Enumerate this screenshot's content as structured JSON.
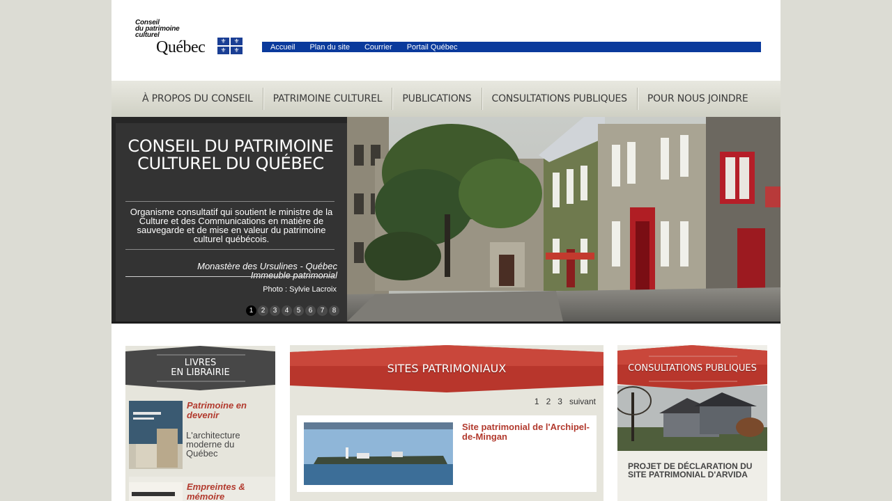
{
  "logo": {
    "line1": "Conseil",
    "line2": "du patrimoine",
    "line3": "culturel",
    "brand": "Québec"
  },
  "topbar": {
    "links": [
      "Accueil",
      "Plan du site",
      "Courrier",
      "Portail Québec"
    ]
  },
  "nav": {
    "items": [
      "À PROPOS DU CONSEIL",
      "PATRIMOINE CULTUREL",
      "PUBLICATIONS",
      "CONSULTATIONS PUBLIQUES",
      "POUR NOUS JOINDRE"
    ]
  },
  "hero": {
    "title": "CONSEIL DU PATRIMOINE CULTUREL DU QUÉBEC",
    "description": "Organisme consultatif qui soutient le ministre de la Culture et des Communications en matière de sauvegarde et de mise en valeur du patrimoine culturel québécois.",
    "caption_line1": "Monastère des Ursulines - Québec",
    "caption_line2": "Immeuble patrimonial",
    "credit": "Photo : Sylvie Lacroix",
    "slides": [
      "1",
      "2",
      "3",
      "4",
      "5",
      "6",
      "7",
      "8"
    ],
    "active_slide": 1
  },
  "books": {
    "heading_line1": "LIVRES",
    "heading_line2": "EN LIBRAIRIE",
    "items": [
      {
        "title": "Patrimoine en devenir",
        "subtitle": "L'architecture moderne du Québec"
      },
      {
        "title": "Empreintes & mémoire",
        "subtitle": ""
      }
    ]
  },
  "sites": {
    "heading": "SITES PATRIMONIAUX",
    "pages": [
      "1",
      "2",
      "3"
    ],
    "next_label": "suivant",
    "card_title": "Site patrimonial de l'Archipel-de-Mingan"
  },
  "consultations": {
    "heading": "CONSULTATIONS PUBLIQUES",
    "item_title": "PROJET DE DÉCLARATION DU SITE PATRIMONIAL D'ARVIDA"
  },
  "colors": {
    "topbar": "#0a3a9c",
    "accent_red": "#b23a2e",
    "hero_panel": "#333333"
  }
}
